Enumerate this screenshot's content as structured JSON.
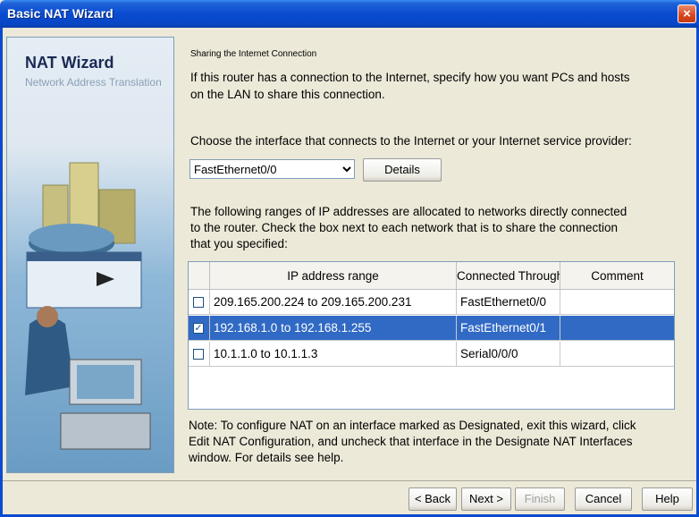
{
  "window": {
    "title": "Basic NAT Wizard",
    "close_label": "×"
  },
  "sidebar": {
    "heading": "NAT Wizard",
    "subheading": "Network Address Translation"
  },
  "main": {
    "section_title": "Sharing the Internet Connection",
    "intro_line1": "If this router has a connection to the Internet, specify how you want PCs and hosts",
    "intro_line2": "on the LAN to share this connection.",
    "choose_label": "Choose the interface that connects to the Internet or your Internet service provider:",
    "interface_selected": "FastEthernet0/0",
    "details_label": "Details",
    "ranges_line1": "The following ranges of IP addresses are allocated to networks directly connected",
    "ranges_line2": "to the router. Check the box next to each network that is to share the connection",
    "ranges_line3": "that you specified:",
    "table": {
      "headers": [
        "IP address range",
        "Connected Through",
        "Comment"
      ],
      "rows": [
        {
          "checked": false,
          "range": "209.165.200.224 to 209.165.200.231",
          "iface": "FastEthernet0/0",
          "comment": ""
        },
        {
          "checked": true,
          "range": "192.168.1.0 to 192.168.1.255",
          "iface": "FastEthernet0/1",
          "comment": ""
        },
        {
          "checked": false,
          "range": "10.1.1.0 to 10.1.1.3",
          "iface": "Serial0/0/0",
          "comment": ""
        }
      ]
    },
    "note_line1": "Note: To configure NAT on an interface marked as Designated, exit this wizard, click",
    "note_line2": "Edit NAT Configuration, and uncheck that interface in the Designate NAT Interfaces",
    "note_line3": "window. For details see help."
  },
  "buttons": {
    "back": "< Back",
    "next": "Next >",
    "finish": "Finish",
    "cancel": "Cancel",
    "help": "Help"
  },
  "colors": {
    "titlebar": "#0a4bd0",
    "selection": "#316ac5",
    "dialog_bg": "#ece9d8"
  }
}
